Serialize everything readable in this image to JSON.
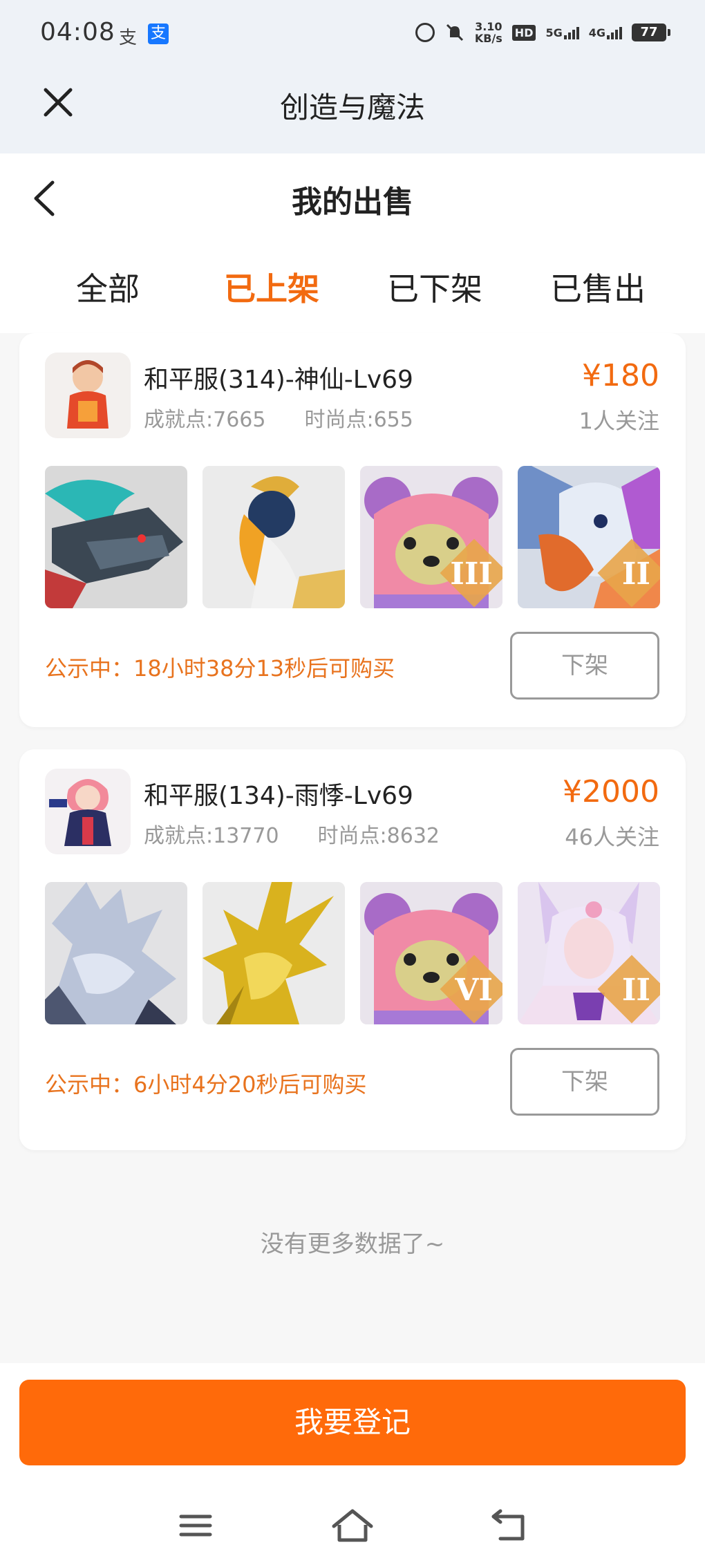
{
  "status_bar": {
    "time": "04:08",
    "app_icons": [
      "支",
      "支"
    ],
    "net_speed": [
      "3.10",
      "KB/s"
    ],
    "hd": "HD",
    "sig1": "5G",
    "sig2": "4G",
    "battery": "77"
  },
  "webview": {
    "title": "创造与魔法"
  },
  "page": {
    "title": "我的出售",
    "tabs": [
      {
        "label": "全部",
        "active": false
      },
      {
        "label": "已上架",
        "active": true
      },
      {
        "label": "已下架",
        "active": false
      },
      {
        "label": "已售出",
        "active": false
      }
    ]
  },
  "listings": [
    {
      "title": "和平服(314)-神仙-Lv69",
      "achievement": "成就点:7665",
      "fashion": "时尚点:655",
      "price": "¥180",
      "followers": "1人关注",
      "thumbs": [
        {
          "name": "mech-dragon-mount",
          "rank": ""
        },
        {
          "name": "hornbill-mount",
          "rank": ""
        },
        {
          "name": "pink-bear-mount",
          "rank": "III"
        },
        {
          "name": "griffin-mount",
          "rank": "II"
        }
      ],
      "notice": "公示中：18小时38分13秒后可购买",
      "action_label": "下架"
    },
    {
      "title": "和平服(134)-雨悸-Lv69",
      "achievement": "成就点:13770",
      "fashion": "时尚点:8632",
      "price": "¥2000",
      "followers": "46人关注",
      "thumbs": [
        {
          "name": "silver-dragon-mount",
          "rank": ""
        },
        {
          "name": "golden-phoenix-mount",
          "rank": ""
        },
        {
          "name": "pink-bear-mount",
          "rank": "VI"
        },
        {
          "name": "fox-spirit-mount",
          "rank": "II"
        }
      ],
      "notice": "公示中：6小时4分20秒后可购买",
      "action_label": "下架"
    }
  ],
  "list_end_text": "没有更多数据了~",
  "register_button": "我要登记",
  "colors": {
    "accent": "#f26a10",
    "button": "#ff6a0a",
    "notice": "#e8731e"
  },
  "nav_icons": [
    "menu-icon",
    "home-icon",
    "back-icon"
  ]
}
